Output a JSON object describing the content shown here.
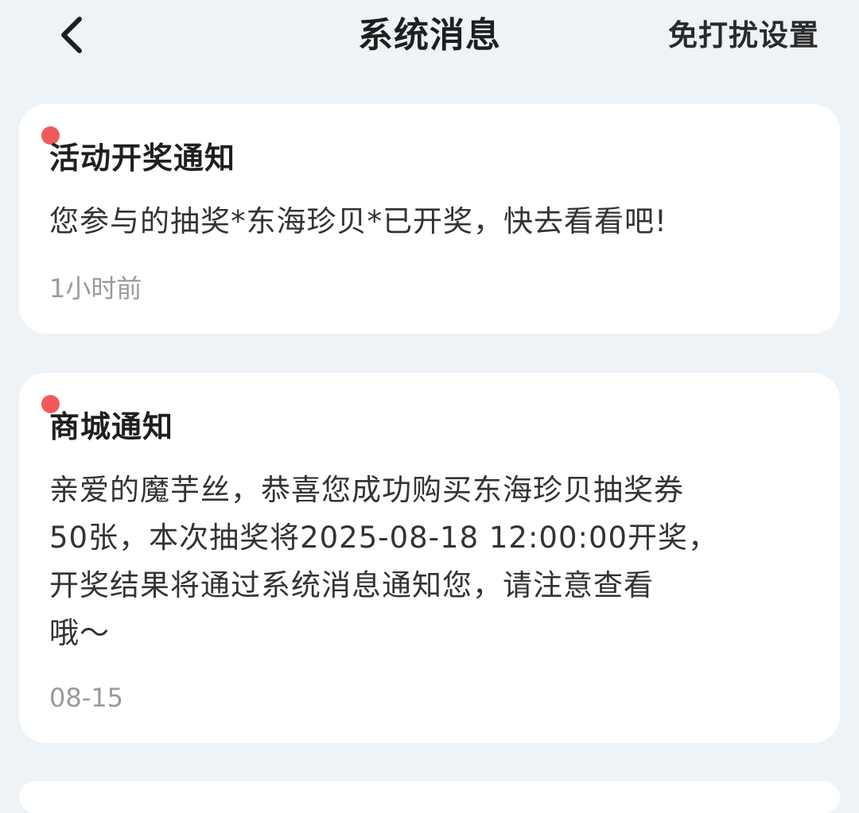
{
  "header": {
    "title": "系统消息",
    "dnd_label": "免打扰设置",
    "back_icon": "chevron-left-icon"
  },
  "messages": [
    {
      "title": "活动开奖通知",
      "body": "您参与的抽奖*东海珍贝*已开奖，快去看看吧!",
      "time": "1小时前",
      "unread": true
    },
    {
      "title": "商城通知",
      "body": "亲爱的魔芋丝，恭喜您成功购买东海珍贝抽奖券\n50张，本次抽奖将2025-08-18 12:00:00开奖，\n开奖结果将通过系统消息通知您，请注意查看\n哦～",
      "time": "08-15",
      "unread": true
    }
  ],
  "colors": {
    "background": "#eef3f8",
    "card": "#ffffff",
    "unread_dot": "#f25a5a",
    "time_text": "#9a9a9a"
  }
}
